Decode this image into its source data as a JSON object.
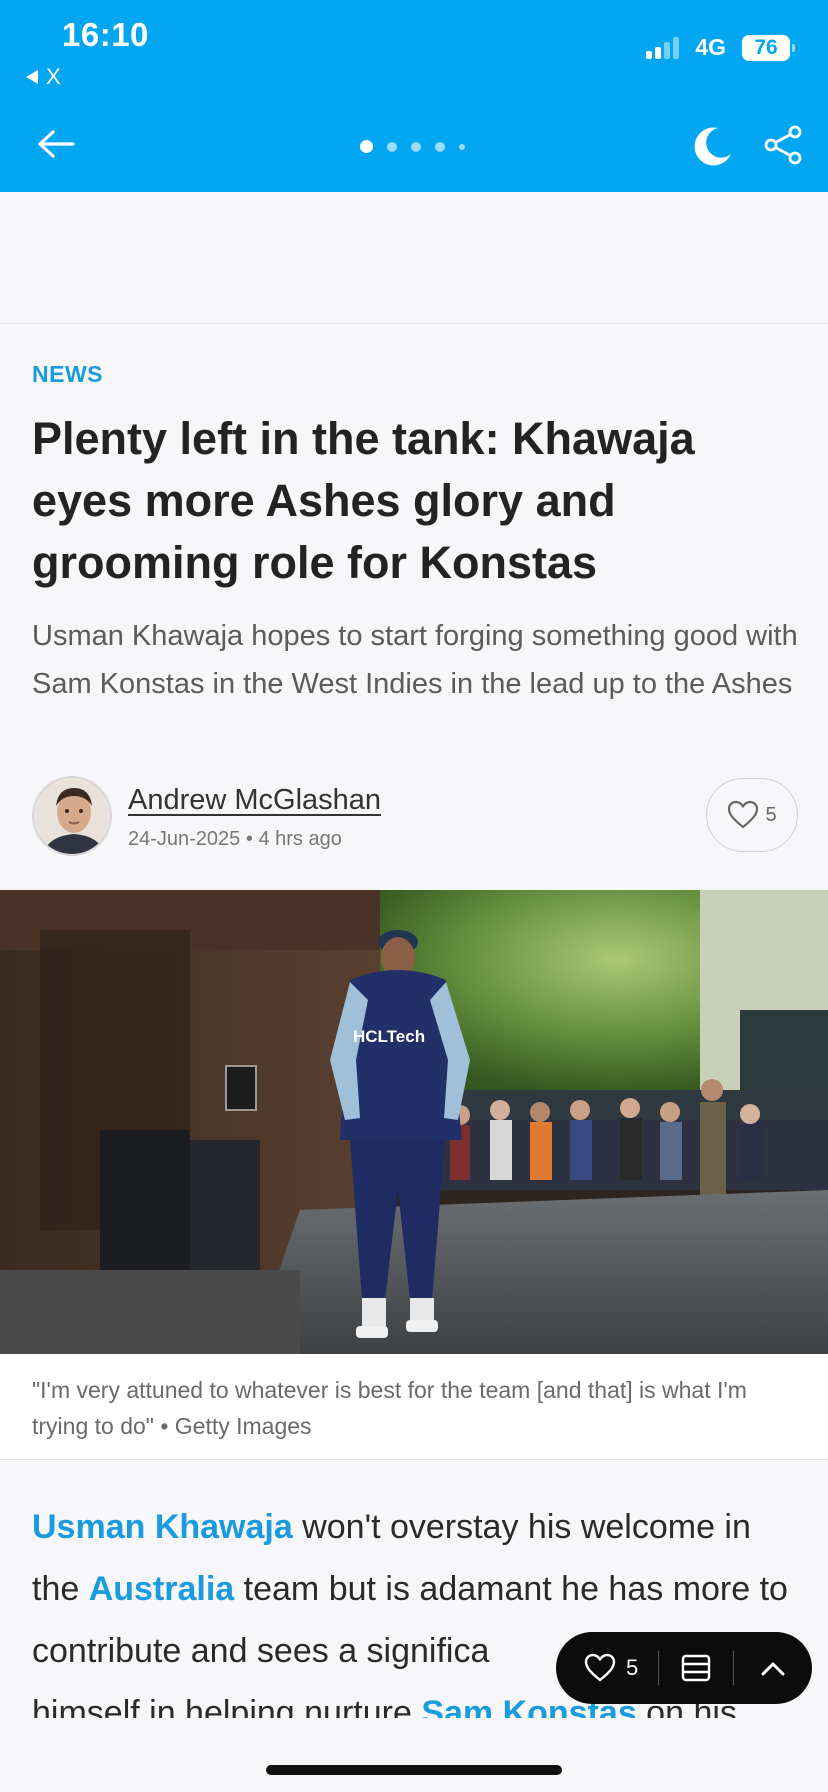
{
  "status_bar": {
    "time": "16:10",
    "back_app": "X",
    "network": "4G",
    "battery": "76"
  },
  "header": {
    "page_dots": 5,
    "active_dot": 0
  },
  "article": {
    "kicker": "NEWS",
    "headline": "Plenty left in the tank: Khawaja eyes more Ashes glory and grooming role for Konstas",
    "summary": "Usman Khawaja hopes to start forging something good with Sam Konstas in the West Indies in the lead up to the Ashes",
    "author": "Andrew McGlashan",
    "date": "24-Jun-2025",
    "time_ago": "4 hrs ago",
    "likes": "5",
    "caption": "\"I'm very attuned to whatever is best for the team [and that] is what I'm trying to do\" • Getty Images",
    "hero_jersey_text": "HCLTech",
    "body": {
      "link1": "Usman Khawaja",
      "text1": " won't overstay his welcome in the ",
      "link2": "Australia",
      "text2": " team but is adamant he has more to contribute and sees a significa",
      "text3": "himself in helping nurture ",
      "link3": "Sam Konstas",
      "text4": " on his"
    }
  },
  "floating_bar": {
    "likes": "5"
  },
  "colors": {
    "header_bg": "#03a6f0",
    "link": "#1a9be0"
  },
  "icons": [
    "back-arrow-icon",
    "moon-icon",
    "share-icon",
    "heart-icon",
    "list-icon",
    "chevron-up-icon"
  ]
}
